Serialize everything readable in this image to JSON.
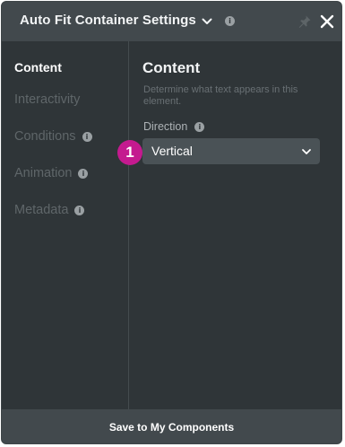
{
  "header": {
    "title": "Auto Fit Container Settings",
    "info_glyph": "i",
    "icons": [
      "chevron-down-icon",
      "info-icon",
      "pin-icon",
      "close-icon"
    ]
  },
  "sidebar": {
    "items": [
      {
        "label": "Content",
        "active": true,
        "has_info": false
      },
      {
        "label": "Interactivity",
        "active": false,
        "has_info": false
      },
      {
        "label": "Conditions",
        "active": false,
        "has_info": true
      },
      {
        "label": "Animation",
        "active": false,
        "has_info": true
      },
      {
        "label": "Metadata",
        "active": false,
        "has_info": true
      }
    ]
  },
  "content": {
    "title": "Content",
    "description": "Determine what text appears in this element.",
    "direction": {
      "label": "Direction",
      "value": "Vertical"
    }
  },
  "callout": {
    "number": "1",
    "color": "#c41a8f"
  },
  "footer": {
    "button_label": "Save to My Components"
  },
  "colors": {
    "panel_bg": "#2f3538",
    "header_bg": "#42494d",
    "select_bg": "#4a5256",
    "muted_text": "#5f6669"
  }
}
